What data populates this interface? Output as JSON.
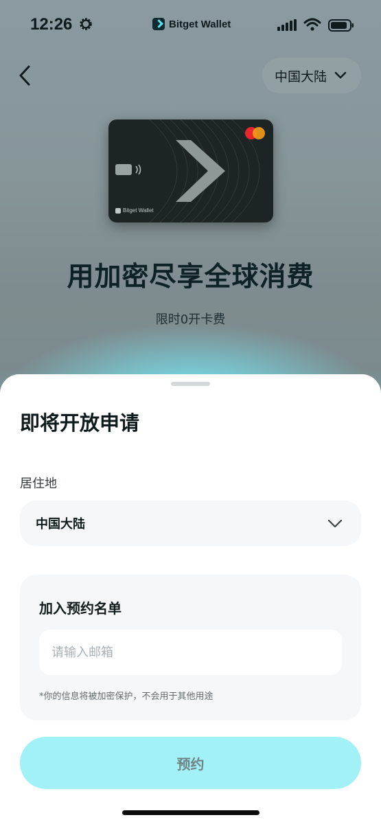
{
  "status_bar": {
    "time": "12:26",
    "app_brand": "Bitget Wallet",
    "icons": [
      "gear-icon",
      "signal-icon",
      "wifi-icon",
      "battery-icon"
    ]
  },
  "header": {
    "back_icon": "chevron-left-icon",
    "region_selector": "中国大陆"
  },
  "card": {
    "brand_label": "Bitget Wallet",
    "network_logo": "mastercard-logo"
  },
  "hero": {
    "title": "用加密尽享全球消费",
    "subtitle": "限时0开卡费"
  },
  "sheet": {
    "title": "即将开放申请",
    "residence_label": "居住地",
    "residence_value": "中国大陆",
    "waitlist": {
      "title": "加入预约名单",
      "email_placeholder": "请输入邮箱",
      "email_value": "",
      "privacy_note": "*你的信息将被加密保护，不会用于其他用途"
    },
    "reserve_button": "预约"
  },
  "colors": {
    "accent": "#a2f1f7",
    "glow": "#78ebfa",
    "text_primary": "#0e2124"
  }
}
